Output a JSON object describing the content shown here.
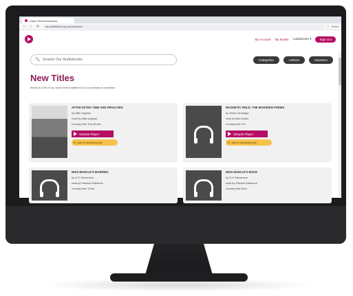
{
  "browser": {
    "tab_title": "Listen Hull Audiobooks",
    "address": "etp.ebibliotek.org.au/collection",
    "menu_label": "Xmen"
  },
  "header": {
    "my_account": "My Account",
    "my_books": "My Books",
    "audiobooks": "Audiobooks ▾",
    "sign_out": "Sign Out"
  },
  "search": {
    "placeholder": "Search Our Audiobooks"
  },
  "filters": [
    "Categories",
    "Authors",
    "Narrators"
  ],
  "page": {
    "title": "New Titles",
    "subtitle": "Below is a list of our most recent additions to our audiobook collection"
  },
  "cards": [
    {
      "title": "AFTER EXTRA TIME AND PENALTIES",
      "by": "by Mike Ingham",
      "read": "read by Mike Ingham",
      "time": "running time 7hrs 8mins",
      "sample": "Sample Player",
      "wish": "Add to streaming list",
      "cover": "photo"
    },
    {
      "title": "MAGNETIC FIELD: THE MARSDEN POEMS",
      "by": "by Simon Armitage",
      "read": "read by Bob Nobel",
      "time": "running time 7hr",
      "sample": "Sample Player",
      "wish": "Add to streaming list",
      "cover": "headphones"
    },
    {
      "title": "MISS BUNCLE'S MARRIED",
      "by": "by D E Stevenson",
      "read": "read by Patricia Gallimore",
      "time": "running time 12hrs",
      "cover": "headphones"
    },
    {
      "title": "MISS BUNCLE'S BOOK",
      "by": "by D E Stevenson",
      "read": "read by Patricia Gallimore",
      "time": "running time 9hrs",
      "cover": "headphones"
    }
  ],
  "colors": {
    "brand": "#b50e63",
    "title": "#8b1c59",
    "pill": "#3a3a3a",
    "wish": "#f6c24a"
  }
}
